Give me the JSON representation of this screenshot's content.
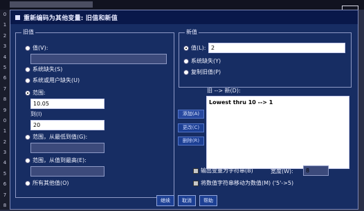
{
  "background": {
    "close_glyph": "×",
    "row_numbers": [
      "0",
      "1",
      "2",
      "3",
      "4",
      "5",
      "6",
      "7",
      "8",
      "9",
      "0",
      "1",
      "2",
      "3",
      "4",
      "5",
      "6",
      "7",
      "8"
    ]
  },
  "dialog": {
    "title": "重新编码为其他变量: 旧值和新值"
  },
  "old_value": {
    "group_title": "旧值",
    "value_label": "值(V):",
    "system_missing_label": "系统缺失(S)",
    "system_or_user_missing_label": "系统或用户缺失(U)",
    "range_label": "范围:",
    "range_low": "10.05",
    "through_label": "到(I)",
    "range_high": "20",
    "lowest_through_label": "范围，从最低到值(G):",
    "highest_through_label": "范围，从值到最高(E):",
    "all_other_label": "所有其他值(O)"
  },
  "new_value": {
    "group_title": "新值",
    "value_label": "值(L):",
    "value": "2",
    "system_missing_label": "系统缺失(Y)",
    "copy_old_label": "复制旧值(P)"
  },
  "mapping": {
    "title": "旧 --> 新(D):",
    "items": [
      "Lowest thru 10 --> 1"
    ]
  },
  "side_buttons": {
    "add_label": "添加(A)",
    "change_label": "更改(C)",
    "remove_label": "删除(R)"
  },
  "options": {
    "output_string_label": "输出变量为字符串(B)",
    "width_label": "宽度(W):",
    "width_value": "8",
    "convert_numeric_label": "将数值字符串移动为数值(M) ('5'->5)"
  },
  "footer": {
    "continue_label": "继续",
    "cancel_label": "取消",
    "help_label": "帮助"
  }
}
